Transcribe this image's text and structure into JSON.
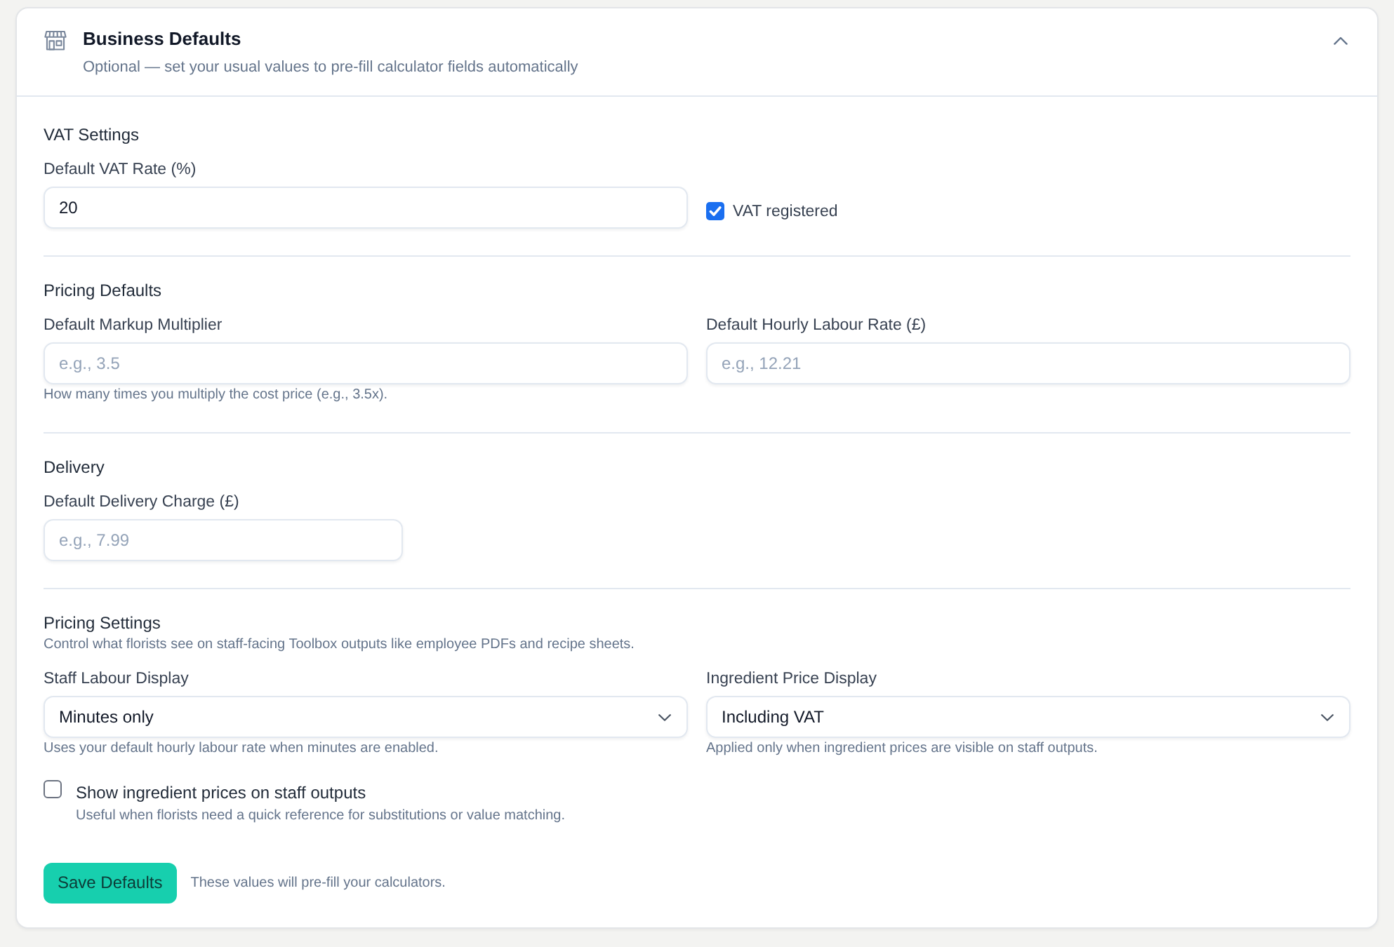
{
  "header": {
    "title": "Business Defaults",
    "subtitle": "Optional — set your usual values to pre-fill calculator fields automatically",
    "expanded": true
  },
  "sections": [
    {
      "title": "VAT Settings",
      "fields": [
        {
          "kind": "input",
          "label": "Default VAT Rate (%)",
          "value": "20"
        },
        {
          "kind": "checkbox",
          "label": "VAT registered",
          "checked": true
        }
      ]
    },
    {
      "title": "Pricing Defaults",
      "fields": [
        {
          "kind": "input",
          "label": "Default Markup Multiplier",
          "placeholder": "e.g., 3.5",
          "hint": "How many times you multiply the cost price (e.g., 3.5x)."
        },
        {
          "kind": "input",
          "label": "Default Hourly Labour Rate (£)",
          "placeholder": "e.g., 12.21"
        }
      ]
    },
    {
      "title": "Delivery",
      "fields": [
        {
          "kind": "compact-input",
          "label": "Default Delivery Charge (£)",
          "placeholder": "e.g., 7.99"
        }
      ]
    },
    {
      "title": "Pricing Settings",
      "description": "Control what florists see on staff-facing Toolbox outputs like employee PDFs and recipe sheets.",
      "fields": [
        {
          "kind": "select",
          "label": "Staff Labour Display",
          "value": "Minutes only",
          "hint": "Uses your default hourly labour rate when minutes are enabled."
        },
        {
          "kind": "select",
          "label": "Ingredient Price Display",
          "value": "Including VAT",
          "hint": "Applied only when ingredient prices are visible on staff outputs."
        },
        {
          "kind": "checkbox-option",
          "label": "Show ingredient prices on staff outputs",
          "description": "Useful when florists need a quick reference for substitutions or value matching.",
          "checked": false
        }
      ]
    }
  ],
  "footer": {
    "button": "Save Defaults",
    "note": "These values will pre-fill your calculators."
  }
}
